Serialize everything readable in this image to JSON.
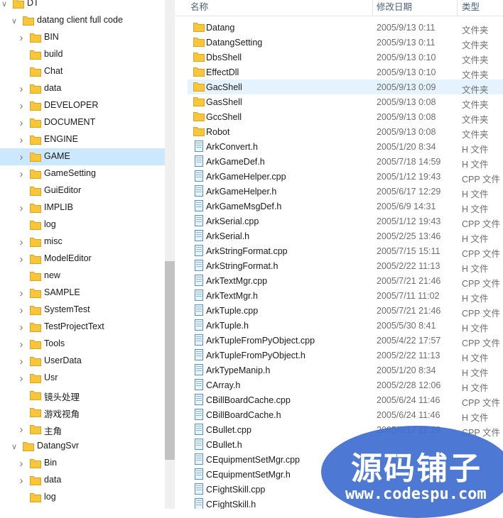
{
  "nav": {
    "items": [
      {
        "label": "DT",
        "depth": 0,
        "expander": "expanded"
      },
      {
        "label": "datang client full code",
        "depth": 1,
        "expander": "expanded"
      },
      {
        "label": "BIN",
        "depth": 2,
        "expander": "collapsed"
      },
      {
        "label": "build",
        "depth": 2,
        "expander": "none"
      },
      {
        "label": "Chat",
        "depth": 2,
        "expander": "none"
      },
      {
        "label": "data",
        "depth": 2,
        "expander": "collapsed"
      },
      {
        "label": "DEVELOPER",
        "depth": 2,
        "expander": "collapsed"
      },
      {
        "label": "DOCUMENT",
        "depth": 2,
        "expander": "collapsed"
      },
      {
        "label": "ENGINE",
        "depth": 2,
        "expander": "collapsed"
      },
      {
        "label": "GAME",
        "depth": 2,
        "expander": "collapsed",
        "selected": true
      },
      {
        "label": "GameSetting",
        "depth": 2,
        "expander": "collapsed"
      },
      {
        "label": "GuiEditor",
        "depth": 2,
        "expander": "none"
      },
      {
        "label": "IMPLIB",
        "depth": 2,
        "expander": "collapsed"
      },
      {
        "label": "log",
        "depth": 2,
        "expander": "none"
      },
      {
        "label": "misc",
        "depth": 2,
        "expander": "collapsed"
      },
      {
        "label": "ModelEditor",
        "depth": 2,
        "expander": "collapsed"
      },
      {
        "label": "new",
        "depth": 2,
        "expander": "none"
      },
      {
        "label": "SAMPLE",
        "depth": 2,
        "expander": "collapsed"
      },
      {
        "label": "SystemTest",
        "depth": 2,
        "expander": "collapsed"
      },
      {
        "label": "TestProjectText",
        "depth": 2,
        "expander": "collapsed"
      },
      {
        "label": "Tools",
        "depth": 2,
        "expander": "collapsed"
      },
      {
        "label": "UserData",
        "depth": 2,
        "expander": "collapsed"
      },
      {
        "label": "Usr",
        "depth": 2,
        "expander": "collapsed"
      },
      {
        "label": "镜头处理",
        "depth": 2,
        "expander": "none"
      },
      {
        "label": "游戏视角",
        "depth": 2,
        "expander": "none"
      },
      {
        "label": "主角",
        "depth": 2,
        "expander": "collapsed"
      },
      {
        "label": "DatangSvr",
        "depth": 1,
        "expander": "expanded"
      },
      {
        "label": "Bin",
        "depth": 2,
        "expander": "collapsed"
      },
      {
        "label": "data",
        "depth": 2,
        "expander": "collapsed"
      },
      {
        "label": "log",
        "depth": 2,
        "expander": "none"
      }
    ]
  },
  "list": {
    "columns": {
      "name": "名称",
      "date": "修改日期",
      "type": "类型"
    },
    "rows": [
      {
        "kind": "folder",
        "name": "Datang",
        "date": "2005/9/13 0:11",
        "type": "文件夹"
      },
      {
        "kind": "folder",
        "name": "DatangSetting",
        "date": "2005/9/13 0:11",
        "type": "文件夹"
      },
      {
        "kind": "folder",
        "name": "DbsShell",
        "date": "2005/9/13 0:10",
        "type": "文件夹"
      },
      {
        "kind": "folder",
        "name": "EffectDll",
        "date": "2005/9/13 0:10",
        "type": "文件夹"
      },
      {
        "kind": "folder",
        "name": "GacShell",
        "date": "2005/9/13 0:09",
        "type": "文件夹",
        "hover": true
      },
      {
        "kind": "folder",
        "name": "GasShell",
        "date": "2005/9/13 0:08",
        "type": "文件夹"
      },
      {
        "kind": "folder",
        "name": "GccShell",
        "date": "2005/9/13 0:08",
        "type": "文件夹"
      },
      {
        "kind": "folder",
        "name": "Robot",
        "date": "2005/9/13 0:08",
        "type": "文件夹"
      },
      {
        "kind": "file",
        "name": "ArkConvert.h",
        "date": "2005/1/20 8:34",
        "type": "H 文件"
      },
      {
        "kind": "file",
        "name": "ArkGameDef.h",
        "date": "2005/7/18 14:59",
        "type": "H 文件"
      },
      {
        "kind": "file",
        "name": "ArkGameHelper.cpp",
        "date": "2005/1/12 19:43",
        "type": "CPP 文件"
      },
      {
        "kind": "file",
        "name": "ArkGameHelper.h",
        "date": "2005/6/17 12:29",
        "type": "H 文件"
      },
      {
        "kind": "file",
        "name": "ArkGameMsgDef.h",
        "date": "2005/6/9 14:31",
        "type": "H 文件"
      },
      {
        "kind": "file",
        "name": "ArkSerial.cpp",
        "date": "2005/1/12 19:43",
        "type": "CPP 文件"
      },
      {
        "kind": "file",
        "name": "ArkSerial.h",
        "date": "2005/2/25 13:46",
        "type": "H 文件"
      },
      {
        "kind": "file",
        "name": "ArkStringFormat.cpp",
        "date": "2005/7/15 15:11",
        "type": "CPP 文件"
      },
      {
        "kind": "file",
        "name": "ArkStringFormat.h",
        "date": "2005/2/22 11:13",
        "type": "H 文件"
      },
      {
        "kind": "file",
        "name": "ArkTextMgr.cpp",
        "date": "2005/7/21 21:46",
        "type": "CPP 文件"
      },
      {
        "kind": "file",
        "name": "ArkTextMgr.h",
        "date": "2005/7/11 11:02",
        "type": "H 文件"
      },
      {
        "kind": "file",
        "name": "ArkTuple.cpp",
        "date": "2005/7/21 21:46",
        "type": "CPP 文件"
      },
      {
        "kind": "file",
        "name": "ArkTuple.h",
        "date": "2005/5/30 8:41",
        "type": "H 文件"
      },
      {
        "kind": "file",
        "name": "ArkTupleFromPyObject.cpp",
        "date": "2005/4/22 17:57",
        "type": "CPP 文件"
      },
      {
        "kind": "file",
        "name": "ArkTupleFromPyObject.h",
        "date": "2005/2/22 11:13",
        "type": "H 文件"
      },
      {
        "kind": "file",
        "name": "ArkTypeManip.h",
        "date": "2005/1/20 8:34",
        "type": "H 文件"
      },
      {
        "kind": "file",
        "name": "CArray.h",
        "date": "2005/2/28 12:06",
        "type": "H 文件"
      },
      {
        "kind": "file",
        "name": "CBillBoardCache.cpp",
        "date": "2005/6/24 11:46",
        "type": "CPP 文件"
      },
      {
        "kind": "file",
        "name": "CBillBoardCache.h",
        "date": "2005/6/24 11:46",
        "type": "H 文件"
      },
      {
        "kind": "file",
        "name": "CBullet.cpp",
        "date": "2005/6/17 12:29",
        "type": "CPP 文件"
      },
      {
        "kind": "file",
        "name": "CBullet.h",
        "date": "",
        "type": ""
      },
      {
        "kind": "file",
        "name": "CEquipmentSetMgr.cpp",
        "date": "",
        "type": ""
      },
      {
        "kind": "file",
        "name": "CEquipmentSetMgr.h",
        "date": "",
        "type": ""
      },
      {
        "kind": "file",
        "name": "CFightSkill.cpp",
        "date": "",
        "type": ""
      },
      {
        "kind": "file",
        "name": "CFightSkill.h",
        "date": "",
        "type": ""
      }
    ]
  },
  "watermark": {
    "title": "源码铺子",
    "url": "www.codespu.com"
  },
  "colors": {
    "selection": "#cce8ff",
    "hover": "#e5f3ff",
    "folder": "#f8c63a",
    "watermark": "#3f6fd1"
  }
}
